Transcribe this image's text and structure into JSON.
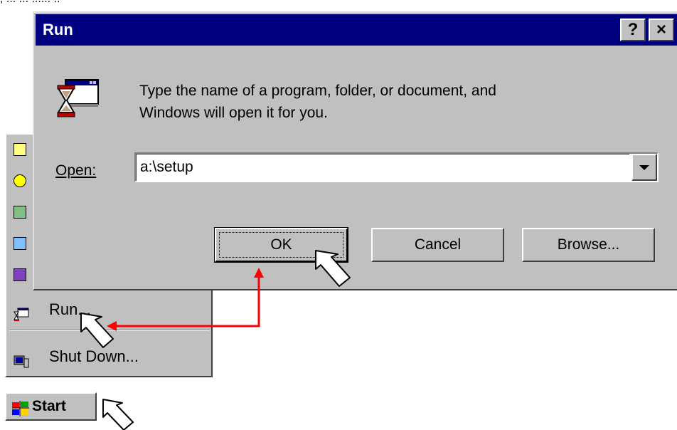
{
  "background_fragment": ", ... ... ...... ..",
  "run_dialog": {
    "title": "Run",
    "help_button": "?",
    "close_button": "×",
    "prompt_line1": "Type the name of a program, folder, or document, and",
    "prompt_line2": "Windows will open it for you.",
    "open_label": "Open:",
    "open_value": "a:\\setup",
    "ok_label": "OK",
    "cancel_label": "Cancel",
    "browse_label": "Browse..."
  },
  "start_menu": {
    "run_label": "Run...",
    "shutdown_label": "Shut Down..."
  },
  "taskbar": {
    "start_label": "Start"
  },
  "colors": {
    "title_bar": "#000080",
    "face": "#c0c0c0",
    "annotation_arrow": "#ff0000"
  }
}
